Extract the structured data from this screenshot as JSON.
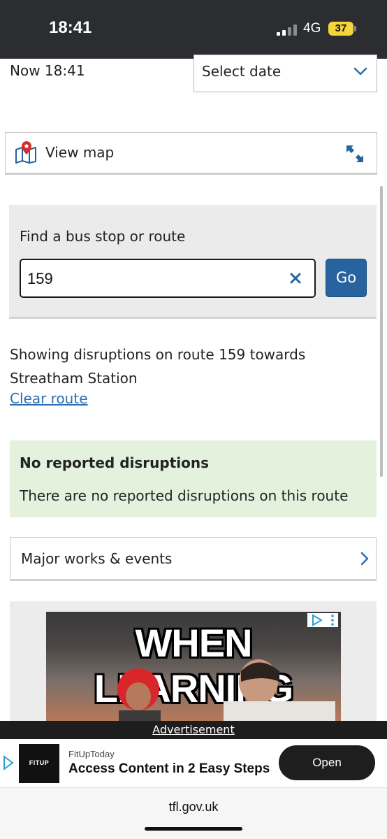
{
  "status_bar": {
    "time": "18:41",
    "network": "4G",
    "battery": "37"
  },
  "date_row": {
    "now_label": "Now 18:41",
    "date_select": "Select date"
  },
  "view_map": {
    "label": "View map",
    "icons": [
      "map-pin-icon",
      "expand-arrows-icon"
    ]
  },
  "search": {
    "heading": "Find a bus stop or route",
    "value": "159",
    "go_label": "Go"
  },
  "route_info": {
    "showing_text": "Showing disruptions on route 159 towards Streatham Station",
    "clear_route": "Clear route"
  },
  "status_box": {
    "title": "No reported disruptions",
    "description": "There are no reported disruptions on this route"
  },
  "major_works": {
    "label": "Major works & events"
  },
  "ad": {
    "headline": "WHEN LEARNING",
    "label": "Advertisement",
    "logo_text": "FITUP",
    "advertiser": "FitUpToday",
    "title": "Access Content in 2 Easy Steps",
    "cta": "Open"
  },
  "browser": {
    "url": "tfl.gov.uk"
  },
  "colors": {
    "accent_blue": "#27639e",
    "link_blue": "#2b6fb0",
    "success_bg": "#e3f1dd",
    "panel_bg": "#ebebeb"
  }
}
